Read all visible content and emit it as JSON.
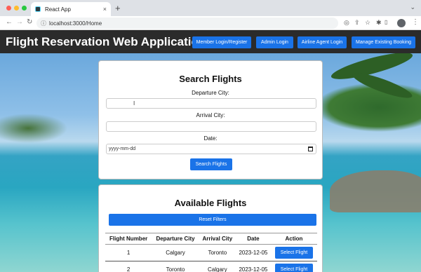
{
  "browser": {
    "tab_title": "React App",
    "tab_close": "×",
    "new_tab": "+",
    "url": "localhost:3000/Home",
    "icons": [
      "back-icon",
      "forward-icon",
      "reload-icon",
      "info-icon",
      "share-icon",
      "bookmark-icon",
      "extensions-icon",
      "sidebar-icon",
      "profile-icon",
      "menu-icon"
    ]
  },
  "header": {
    "title": "Flight Reservation Web Application",
    "buttons": [
      "Member Login/Register",
      "Admin Login",
      "Airline Agent Login",
      "Manage Existing Booking"
    ]
  },
  "search": {
    "title": "Search Flights",
    "departure_label": "Departure City:",
    "departure_value": "",
    "arrival_label": "Arrival City:",
    "arrival_value": "",
    "date_label": "Date:",
    "date_placeholder": "yyyy-mm-dd",
    "button": "Search Flights"
  },
  "flights": {
    "title": "Available Flights",
    "reset_button": "Reset Filters",
    "columns": [
      "Flight Number",
      "Departure City",
      "Arrival City",
      "Date",
      "Action"
    ],
    "rows": [
      {
        "number": "1",
        "departure": "Calgary",
        "arrival": "Toronto",
        "date": "2023-12-05",
        "action": "Select Flight"
      },
      {
        "number": "2",
        "departure": "Toronto",
        "arrival": "Calgary",
        "date": "2023-12-05",
        "action": "Select Flight"
      }
    ]
  },
  "colors": {
    "accent": "#1a73e8",
    "header_bg": "#2b2b2b"
  }
}
